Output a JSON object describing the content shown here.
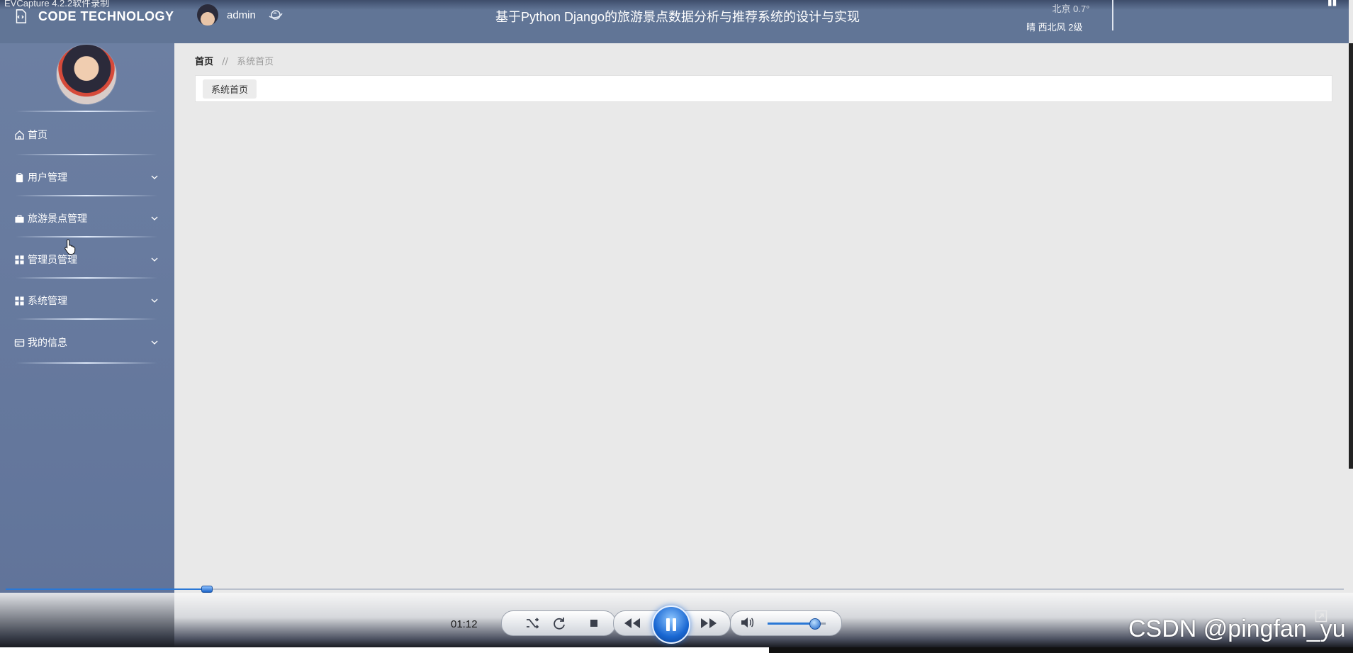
{
  "capture_caption": "EVCapture 4.2.2软件录制",
  "header": {
    "brand": "CODE TECHNOLOGY",
    "username": "admin",
    "system_title": "基于Python Django的旅游景点数据分析与推荐系统的设计与实现",
    "weather": {
      "city_temp": "北京  0.7°",
      "desc": "晴  西北风  2级"
    }
  },
  "sidebar": {
    "items": [
      {
        "label": "首页",
        "icon": "home-icon",
        "expandable": false
      },
      {
        "label": "用户管理",
        "icon": "clipboard-icon",
        "expandable": true
      },
      {
        "label": "旅游景点管理",
        "icon": "briefcase-icon",
        "expandable": true
      },
      {
        "label": "管理员管理",
        "icon": "grid-icon",
        "expandable": true
      },
      {
        "label": "系统管理",
        "icon": "grid-icon",
        "expandable": true
      },
      {
        "label": "我的信息",
        "icon": "card-icon",
        "expandable": true
      }
    ]
  },
  "breadcrumb": {
    "home": "首页",
    "separator": "//",
    "current": "系统首页"
  },
  "tabs": [
    {
      "label": "系统首页",
      "active": true
    }
  ],
  "player": {
    "time": "01:12",
    "seek_progress": 0.15,
    "volume": 0.8
  },
  "watermark": "CSDN @pingfan_yu",
  "colors": {
    "header_bg": "#617596",
    "sidebar_bg": "#647799",
    "content_bg": "#e9e9e9",
    "player_accent": "#1967d2"
  }
}
